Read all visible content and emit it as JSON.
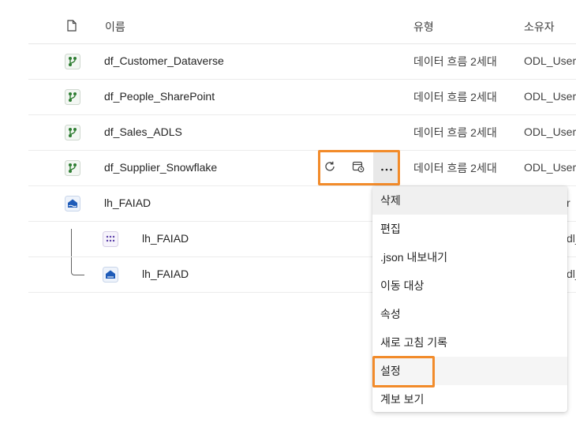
{
  "header": {
    "name_col": "이름",
    "type_col": "유형",
    "owner_col": "소유자"
  },
  "rows": [
    {
      "name": "df_Customer_Dataverse",
      "type": "데이터 흐름 2세대",
      "owner": "ODL_User",
      "icon": "dataflow-icon"
    },
    {
      "name": "df_People_SharePoint",
      "type": "데이터 흐름 2세대",
      "owner": "ODL_User",
      "icon": "dataflow-icon"
    },
    {
      "name": "df_Sales_ADLS",
      "type": "데이터 흐름 2세대",
      "owner": "ODL_User",
      "icon": "dataflow-icon"
    },
    {
      "name": "df_Supplier_Snowflake",
      "type": "데이터 흐름 2세대",
      "owner": "ODL_User",
      "icon": "dataflow-icon"
    },
    {
      "name": "lh_FAIAD",
      "type": "",
      "owner": "r",
      "icon": "lakehouse-icon"
    }
  ],
  "children": [
    {
      "name": "lh_FAIAD",
      "owner": "dl_",
      "icon": "semantic-model-icon"
    },
    {
      "name": "lh_FAIAD",
      "owner": "dl_",
      "icon": "sql-endpoint-icon"
    }
  ],
  "row_actions": [
    "refresh-icon",
    "schedule-icon",
    "more-options-icon"
  ],
  "menu": {
    "items": [
      "삭제",
      "편집",
      ".json 내보내기",
      "이동 대상",
      "속성",
      "새로 고침 기록",
      "설정",
      "계보 보기"
    ],
    "hovered": "삭제",
    "highlighted": "설정"
  },
  "colors": {
    "accent_highlight": "#f28b2a",
    "dataflow_green": "#2e7d32",
    "lakehouse_blue": "#1e5bb8"
  }
}
